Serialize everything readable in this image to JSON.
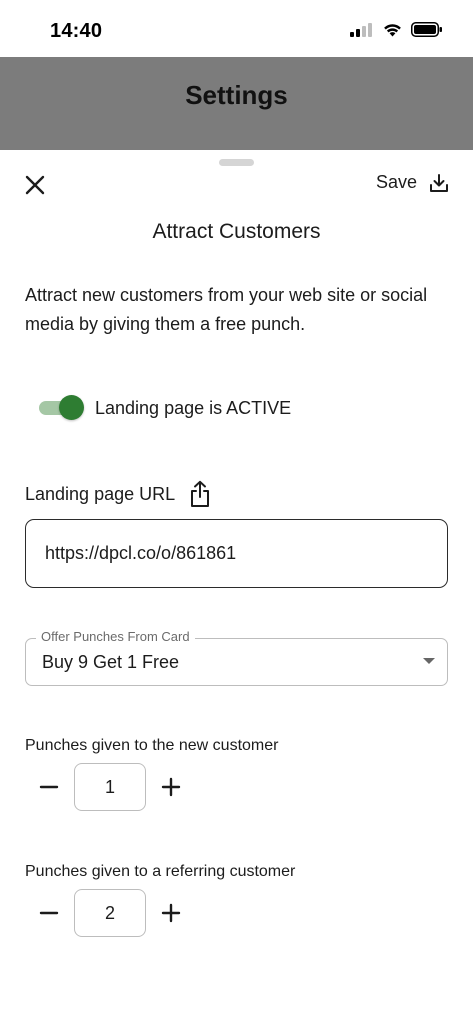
{
  "status_bar": {
    "time": "14:40",
    "icons": [
      "cellular-signal-icon",
      "wifi-icon",
      "battery-icon"
    ]
  },
  "header": {
    "title": "Settings"
  },
  "sheet": {
    "close_icon": "close-icon",
    "save_label": "Save",
    "save_icon": "download-icon",
    "title": "Attract Customers",
    "description": "Attract new customers from your web site or social media by giving them a free punch.",
    "toggle": {
      "on": true,
      "label": "Landing page is ACTIVE"
    },
    "landing_url": {
      "label": "Landing page URL",
      "share_icon": "share-icon",
      "value": "https://dpcl.co/o/861861"
    },
    "offer_select": {
      "label": "Offer Punches From Card",
      "value": "Buy 9 Get 1 Free"
    },
    "new_customer": {
      "label": "Punches given to the new customer",
      "value": "1"
    },
    "referring_customer": {
      "label": "Punches given to a referring customer",
      "value": "2"
    }
  },
  "colors": {
    "header_band": "#7c7c7c",
    "toggle_knob": "#2e7d32",
    "toggle_track": "#a5c7a5"
  }
}
